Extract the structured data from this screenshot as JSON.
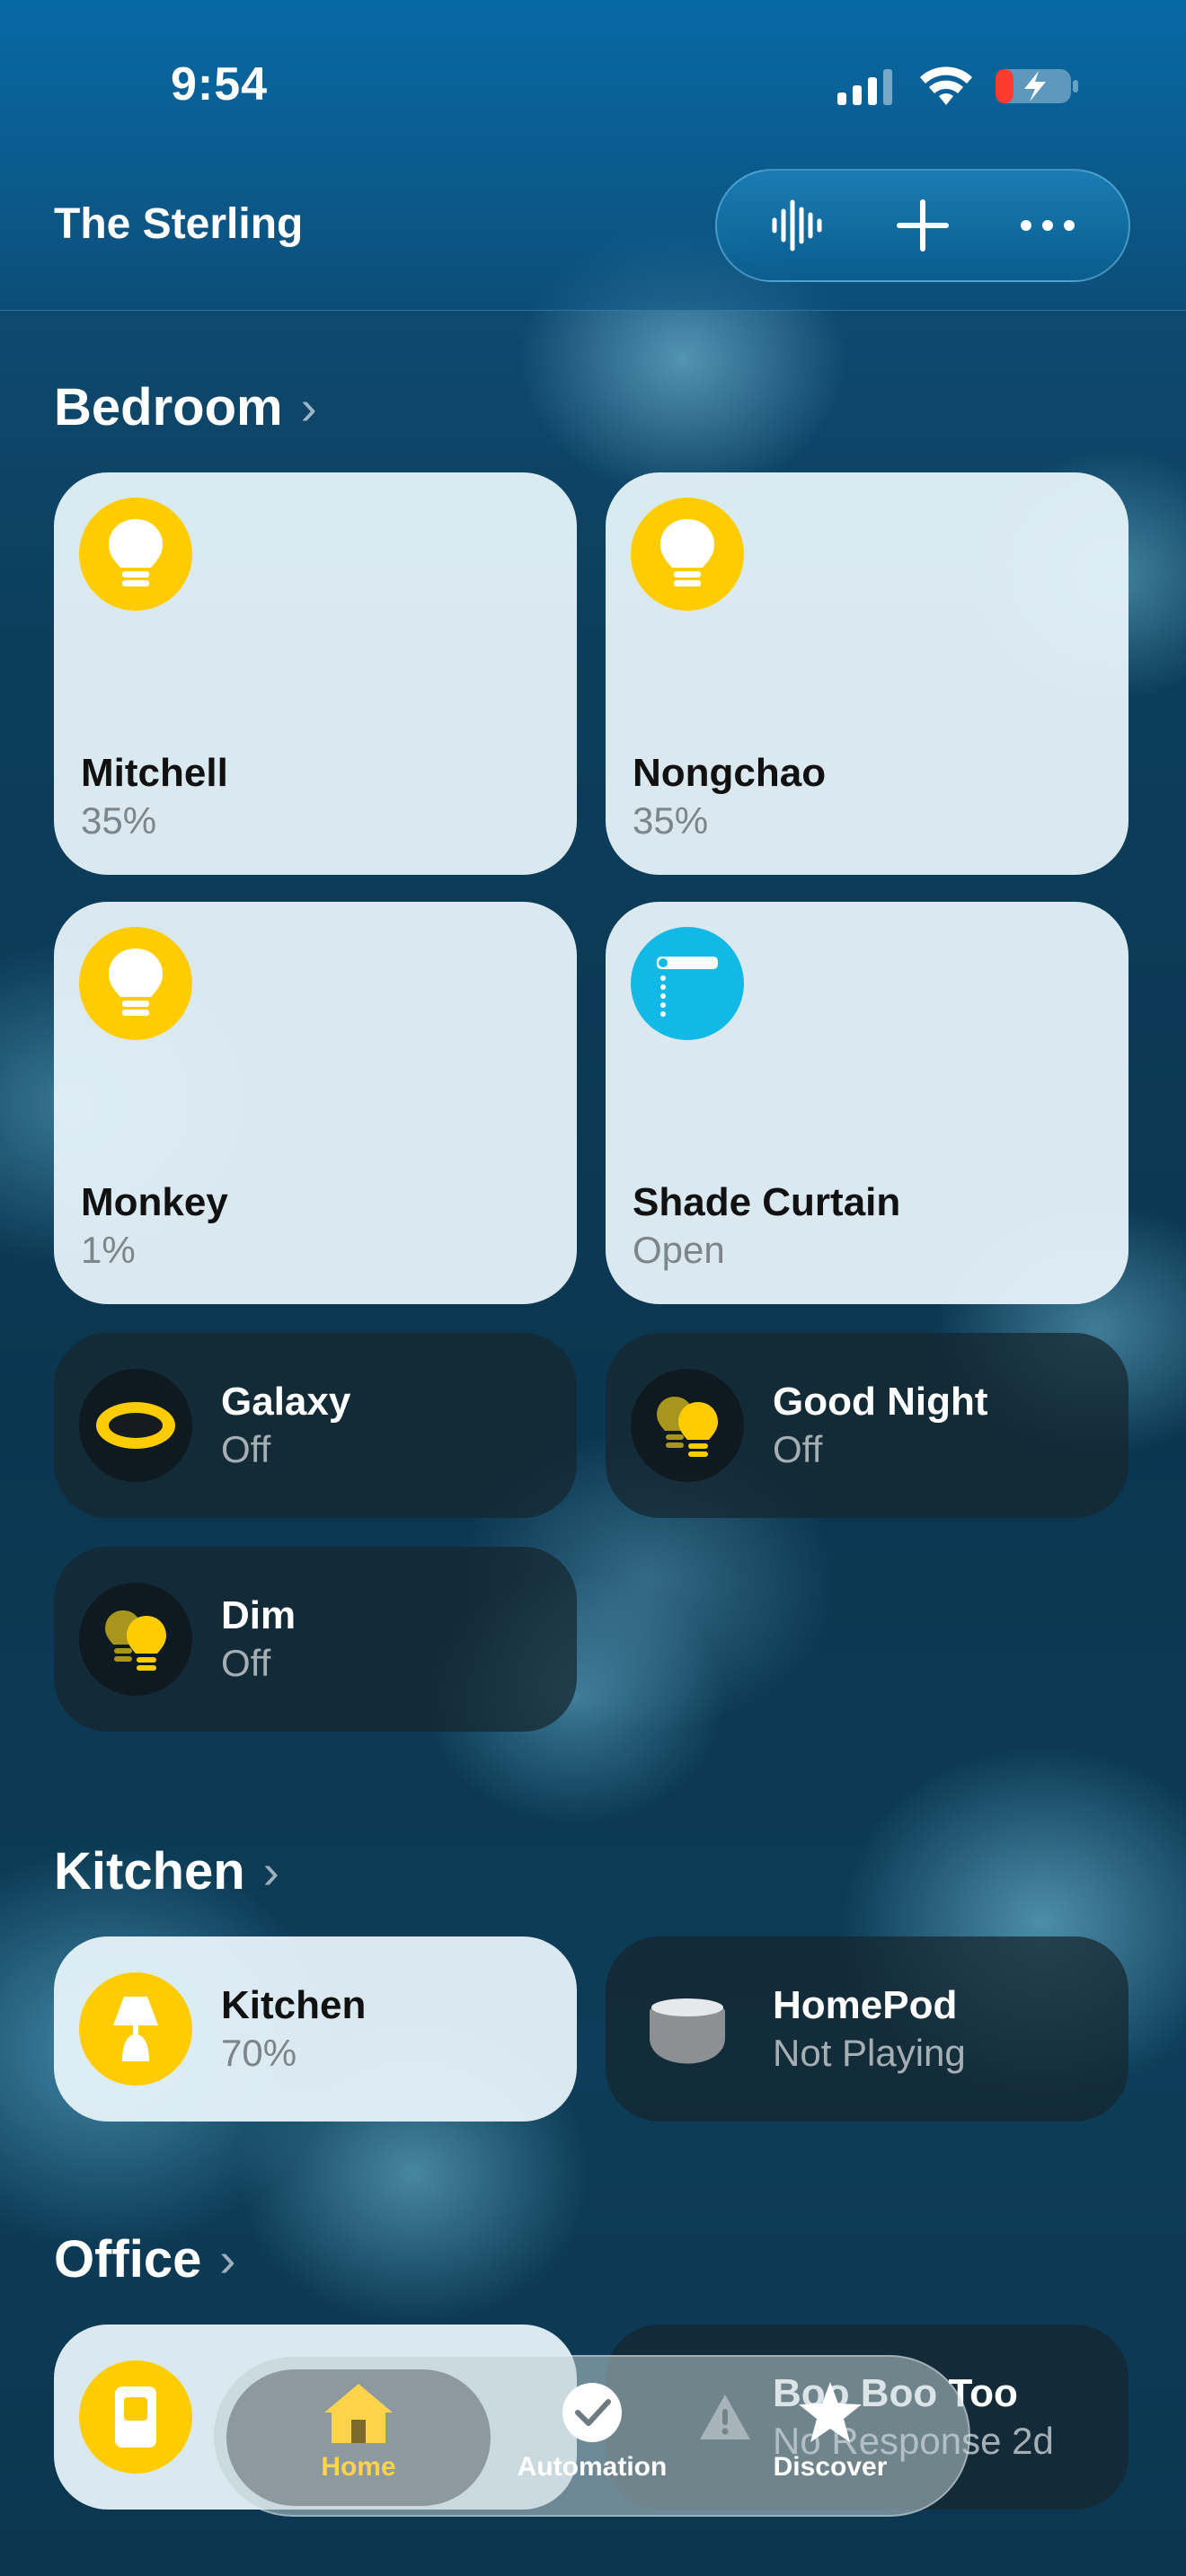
{
  "status_bar": {
    "time": "9:54"
  },
  "header": {
    "title": "The Sterling"
  },
  "toolbar": {
    "intercom_icon": "waveform-icon",
    "add_icon": "plus-icon",
    "more_icon": "ellipsis-icon"
  },
  "sections": {
    "bedroom": {
      "title": "Bedroom",
      "tiles": [
        {
          "name": "Mitchell",
          "state": "35%",
          "icon": "lightbulb-icon"
        },
        {
          "name": "Nongchao",
          "state": "35%",
          "icon": "lightbulb-icon"
        },
        {
          "name": "Monkey",
          "state": "1%",
          "icon": "lightbulb-icon"
        },
        {
          "name": "Shade Curtain",
          "state": "Open",
          "icon": "window-shade-icon"
        },
        {
          "name": "Galaxy",
          "state": "Off",
          "icon": "ceiling-light-icon"
        },
        {
          "name": "Good Night",
          "state": "Off",
          "icon": "scene-bulbs-icon"
        },
        {
          "name": "Dim",
          "state": "Off",
          "icon": "scene-bulbs-icon"
        }
      ]
    },
    "kitchen": {
      "title": "Kitchen",
      "tiles": [
        {
          "name": "Kitchen",
          "state": "70%",
          "icon": "table-lamp-icon"
        },
        {
          "name": "HomePod",
          "state": "Not Playing",
          "icon": "homepod-mini-icon"
        }
      ]
    },
    "office": {
      "title": "Office",
      "tiles": [
        {
          "name": "",
          "state": "",
          "icon": "switch-icon"
        },
        {
          "name": "Boo Boo Too",
          "state": "No Response 2d",
          "icon": "warning-icon"
        }
      ]
    }
  },
  "tabbar": {
    "tabs": [
      {
        "label": "Home",
        "icon": "house-icon",
        "active": true
      },
      {
        "label": "Automation",
        "icon": "clock-icon",
        "active": false
      },
      {
        "label": "Discover",
        "icon": "star-icon",
        "active": false
      }
    ]
  },
  "colors": {
    "accent_yellow": "#FFCC00",
    "shade_blue": "#12B8E6",
    "active_tab": "#FFD34A"
  }
}
